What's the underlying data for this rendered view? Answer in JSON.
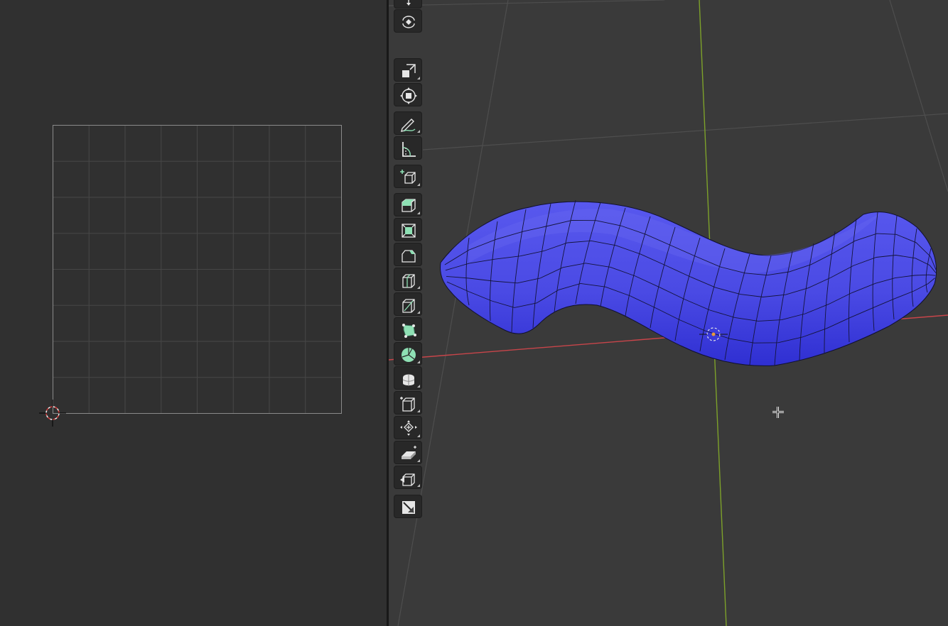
{
  "uv_editor": {
    "background": "#303030",
    "grid_line_color": "#474747",
    "grid_border_color": "#8a8a8a",
    "cursor_icon": "cursor-2d-icon"
  },
  "viewport_3d": {
    "background": "#3a3a3a",
    "x_axis_color": "#c8454a",
    "y_axis_color": "#7da12a",
    "mesh_color": "#4a4ae8",
    "mesh_object": "curved-tube-mesh",
    "origin_icon": "object-origin-icon",
    "crosshair_icon": "mouse-crosshair-icon"
  },
  "toolbar": {
    "active_color": "#8ee0b4",
    "tools": [
      {
        "name": "move",
        "icon": "move-icon",
        "corner": false
      },
      {
        "name": "rotate",
        "icon": "rotate-icon",
        "corner": false
      },
      {
        "name": "scale",
        "icon": "scale-icon",
        "corner": true
      },
      {
        "name": "transform",
        "icon": "transform-icon",
        "corner": false
      },
      {
        "name": "annotate",
        "icon": "annotate-icon",
        "corner": true
      },
      {
        "name": "measure",
        "icon": "measure-icon",
        "corner": false
      },
      {
        "name": "add-cube",
        "icon": "add-cube-icon",
        "corner": true
      },
      {
        "name": "extrude-region",
        "icon": "extrude-region-icon",
        "corner": true
      },
      {
        "name": "inset-faces",
        "icon": "inset-faces-icon",
        "corner": false
      },
      {
        "name": "bevel",
        "icon": "bevel-icon",
        "corner": false
      },
      {
        "name": "loop-cut",
        "icon": "loop-cut-icon",
        "corner": true
      },
      {
        "name": "knife",
        "icon": "knife-icon",
        "corner": true
      },
      {
        "name": "poly-build",
        "icon": "poly-build-icon",
        "corner": false
      },
      {
        "name": "spin",
        "icon": "spin-icon",
        "corner": true
      },
      {
        "name": "smooth",
        "icon": "smooth-icon",
        "corner": true
      },
      {
        "name": "edge-slide",
        "icon": "edge-slide-icon",
        "corner": true
      },
      {
        "name": "shrink-fatten",
        "icon": "shrink-fatten-icon",
        "corner": true
      },
      {
        "name": "shear",
        "icon": "shear-icon",
        "corner": true
      },
      {
        "name": "rip-region",
        "icon": "rip-region-icon",
        "corner": true
      },
      {
        "name": "mesh-cleanup",
        "icon": "mesh-cleanup-icon",
        "corner": false
      }
    ]
  }
}
